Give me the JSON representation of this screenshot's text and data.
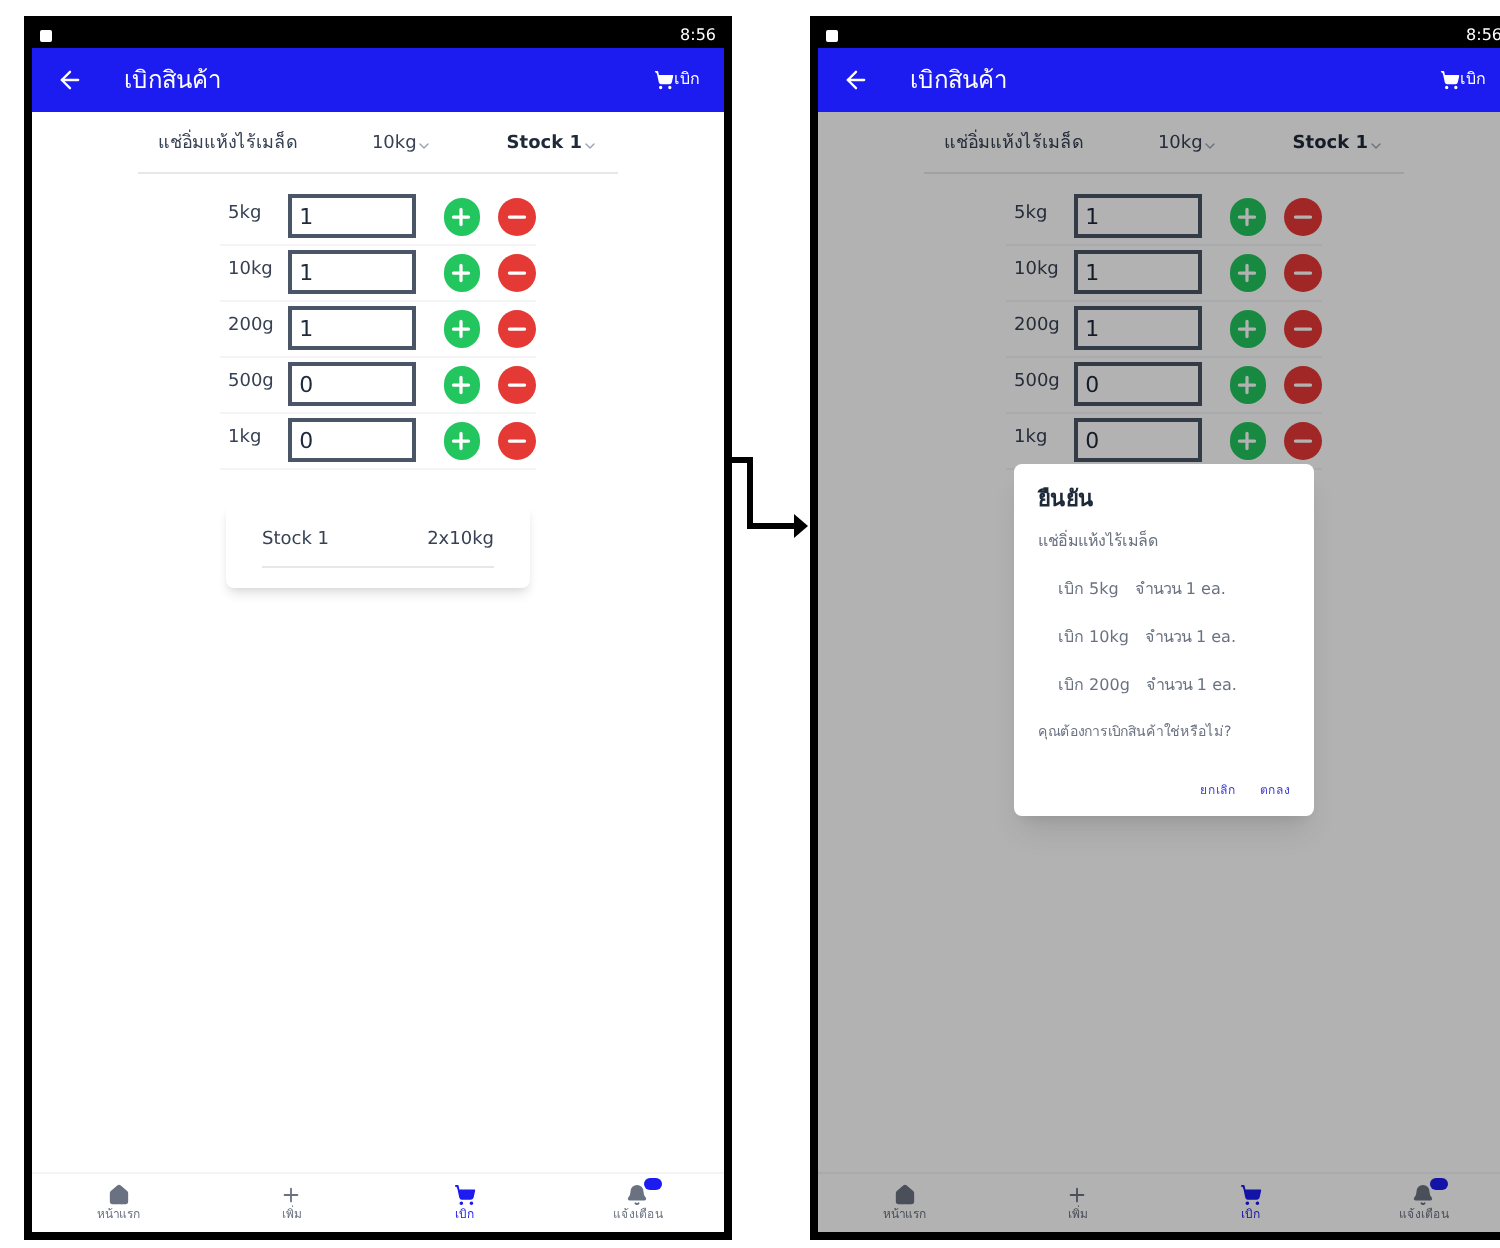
{
  "screens": [
    {
      "time": "8:56",
      "title": "เบิกสินค้า",
      "cart_label": "เบิก",
      "product": "แช่อิ่มแห้งไร้เมล็ด",
      "weight": "10kg",
      "stock": "Stock 1",
      "items": [
        {
          "size": "5kg",
          "qty": "1"
        },
        {
          "size": "10kg",
          "qty": "1"
        },
        {
          "size": "200g",
          "qty": "1"
        },
        {
          "size": "500g",
          "qty": "0"
        },
        {
          "size": "1kg",
          "qty": "0"
        }
      ],
      "summary": [
        {
          "name": "Stock 1",
          "value": "2x10kg"
        }
      ],
      "nav": [
        {
          "label": "หน้าแรก",
          "selected": false
        },
        {
          "label": "เพิ่ม",
          "selected": false
        },
        {
          "label": "เบิก",
          "selected": true
        },
        {
          "label": "แจ้งเตือน",
          "selected": false
        }
      ]
    },
    {
      "time": "8:56",
      "title": "เบิกสินค้า",
      "cart_label": "เบิก",
      "product": "แช่อิ่มแห้งไร้เมล็ด",
      "weight": "10kg",
      "stock": "Stock 1",
      "items": [
        {
          "size": "5kg",
          "qty": "1"
        },
        {
          "size": "10kg",
          "qty": "1"
        },
        {
          "size": "200g",
          "qty": "1"
        },
        {
          "size": "500g",
          "qty": "0"
        },
        {
          "size": "1kg",
          "qty": "0"
        }
      ],
      "nav": [
        {
          "label": "หน้าแรก",
          "selected": false
        },
        {
          "label": "เพิ่ม",
          "selected": false
        },
        {
          "label": "เบิก",
          "selected": true
        },
        {
          "label": "แจ้งเตือน",
          "selected": false
        }
      ],
      "dialog": {
        "title": "ยืนยัน",
        "product": "แช่อิ่มแห้งไร้เมล็ด",
        "lines": [
          {
            "item": "เบิก 5kg",
            "amount": "จำนวน 1 ea."
          },
          {
            "item": "เบิก 10kg",
            "amount": "จำนวน 1 ea."
          },
          {
            "item": "เบิก 200g",
            "amount": "จำนวน 1 ea."
          }
        ],
        "question": "คุณต้องการเบิกสินค้าใช่หรือไม่?",
        "buttons": [
          "ยกเลิก",
          "ตกลง"
        ]
      }
    }
  ]
}
